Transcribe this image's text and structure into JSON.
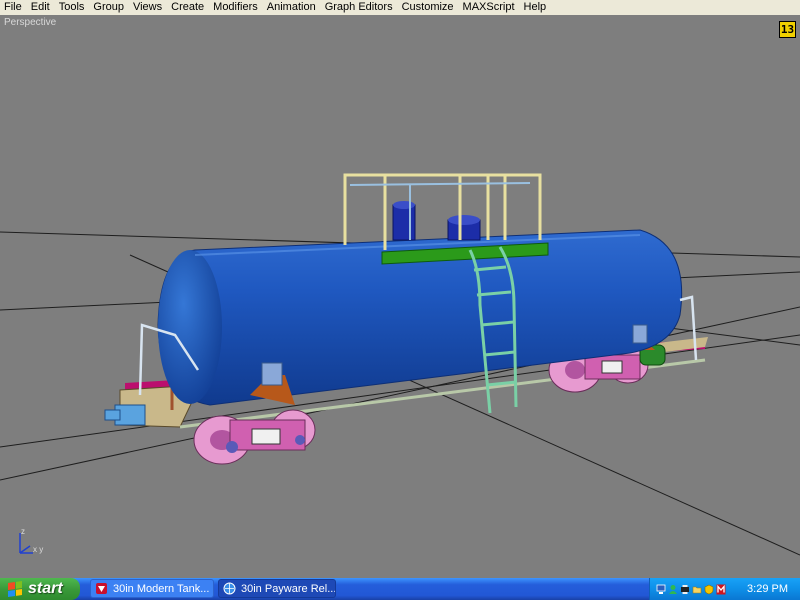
{
  "menu": [
    "File",
    "Edit",
    "Tools",
    "Group",
    "Views",
    "Create",
    "Modifiers",
    "Animation",
    "Graph Editors",
    "Customize",
    "MAXScript",
    "Help"
  ],
  "viewport": {
    "label": "Perspective",
    "icon_text": "13",
    "axis": {
      "z_label": "z",
      "xy_label": "x y"
    }
  },
  "taskbar": {
    "start_label": "start",
    "tasks": [
      {
        "label": "30in Modern Tank...",
        "icon": "archive-icon"
      },
      {
        "label": "30in Payware Rel...",
        "icon": "browser-icon"
      }
    ],
    "clock": "3:29 PM",
    "tray_icons": [
      "network-icon",
      "messenger-icon",
      "printer-icon",
      "folder-icon",
      "security-icon",
      "antivirus-icon"
    ]
  },
  "colors": {
    "viewport_bg": "#7e7e7e",
    "tank_blue": "#1e52b8",
    "trucks_pink": "#e79ad0",
    "frame_magenta": "#bb0f6e",
    "platform_green": "#2b9a1a",
    "railing_yellow": "#e8e0a0",
    "ladder_teal": "#7ad0a6",
    "bolster_orange": "#b7581a"
  }
}
